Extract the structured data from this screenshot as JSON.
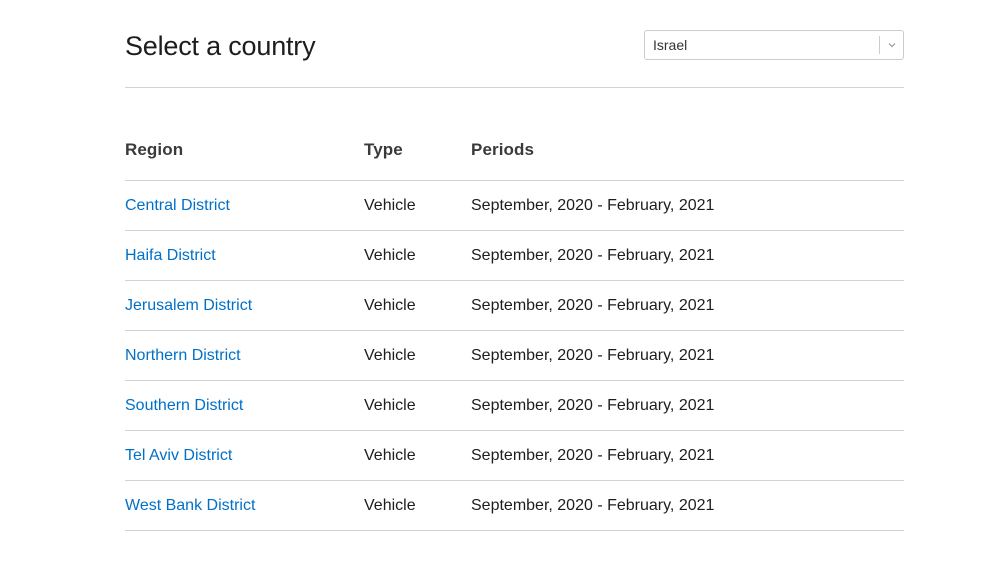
{
  "header": {
    "title": "Select a country",
    "country_select": {
      "selected": "Israel"
    }
  },
  "table": {
    "columns": [
      "Region",
      "Type",
      "Periods"
    ],
    "rows": [
      {
        "region": "Central District",
        "type": "Vehicle",
        "periods": "September, 2020 - February, 2021"
      },
      {
        "region": "Haifa District",
        "type": "Vehicle",
        "periods": "September, 2020 - February, 2021"
      },
      {
        "region": "Jerusalem District",
        "type": "Vehicle",
        "periods": "September, 2020 - February, 2021"
      },
      {
        "region": "Northern District",
        "type": "Vehicle",
        "periods": "September, 2020 - February, 2021"
      },
      {
        "region": "Southern District",
        "type": "Vehicle",
        "periods": "September, 2020 - February, 2021"
      },
      {
        "region": "Tel Aviv District",
        "type": "Vehicle",
        "periods": "September, 2020 - February, 2021"
      },
      {
        "region": "West Bank District",
        "type": "Vehicle",
        "periods": "September, 2020 - February, 2021"
      }
    ]
  },
  "colors": {
    "link": "#0070c9",
    "text": "#1d1d1f",
    "divider": "#d2d2d7"
  }
}
